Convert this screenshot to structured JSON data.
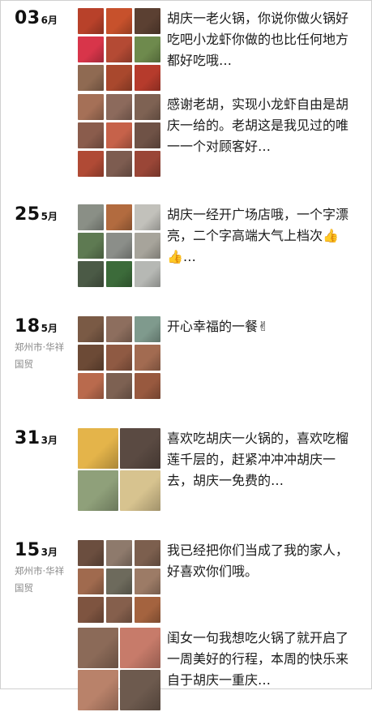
{
  "entries": [
    {
      "day": "03",
      "month": "6月",
      "location": "",
      "posts": [
        {
          "text": "胡庆一老火锅，你说你做火锅好吃吧小龙虾你做的也比任何地方都好吃哦…",
          "layout": "grid9",
          "colors": [
            "#b8412a",
            "#c7512c",
            "#5b4032",
            "#d8354a",
            "#b44a34",
            "#6e8a4d",
            "#8f6a52",
            "#a9482d",
            "#b63b2c"
          ]
        },
        {
          "text": "感谢老胡，实现小龙虾自由是胡庆一给的。老胡这是我见过的唯一一个对顾客好…",
          "layout": "grid9",
          "colors": [
            "#a57057",
            "#8c6a5c",
            "#7e6253",
            "#8a5c4c",
            "#c6624a",
            "#6f5246",
            "#b04a35",
            "#7d5c50",
            "#9a4637"
          ]
        }
      ]
    },
    {
      "day": "25",
      "month": "5月",
      "location": "",
      "posts": [
        {
          "text": "胡庆一经开广场店哦，一个字漂亮，二个字高端大气上档次👍👍…",
          "layout": "grid9",
          "colors": [
            "#8a8f86",
            "#b26b3f",
            "#c2c1bb",
            "#5e7a52",
            "#8b8e89",
            "#a7a49b",
            "#4b5a46",
            "#3c6b3a",
            "#b6b8b4"
          ]
        }
      ]
    },
    {
      "day": "18",
      "month": "5月",
      "location": "郑州市·华祥国贸",
      "posts": [
        {
          "text": "开心幸福的一餐✌",
          "layout": "grid9",
          "colors": [
            "#7a5a45",
            "#8d6e5e",
            "#7f9a8d",
            "#6c4a36",
            "#8f5a43",
            "#a26b51",
            "#b96a4d",
            "#7d6152",
            "#98593f"
          ]
        }
      ]
    },
    {
      "day": "31",
      "month": "3月",
      "location": "",
      "posts": [
        {
          "text": "喜欢吃胡庆一火锅的，喜欢吃榴莲千层的，赶紧冲冲冲胡庆一去，胡庆一免费的…",
          "layout": "grid4",
          "colors": [
            "#e4b44a",
            "#5a4a42",
            "#8fa07a",
            "#d7c38f"
          ]
        }
      ]
    },
    {
      "day": "15",
      "month": "3月",
      "location": "郑州市·华祥国贸",
      "posts": [
        {
          "text": "我已经把你们当成了我的家人，好喜欢你们哦。",
          "layout": "grid9",
          "colors": [
            "#6b4e3f",
            "#8e7a6c",
            "#7c5f4e",
            "#a06a4e",
            "#6d6a5c",
            "#9c7b66",
            "#7e5440",
            "#855f4c",
            "#a4633f"
          ]
        },
        {
          "text": "闺女一句我想吃火锅了就开启了一周美好的行程，本周的快乐来自于胡庆一重庆…",
          "layout": "grid4",
          "colors": [
            "#8b6a58",
            "#c77b6a",
            "#b9826a",
            "#6d5a4e"
          ]
        }
      ]
    }
  ]
}
